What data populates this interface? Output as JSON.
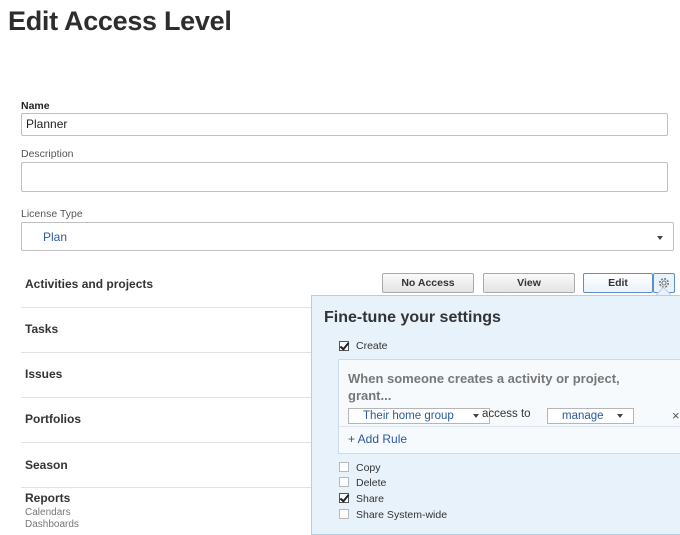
{
  "page": {
    "title": "Edit Access Level"
  },
  "form": {
    "name": {
      "label": "Name",
      "value": "Planner"
    },
    "description": {
      "label": "Description",
      "value": ""
    },
    "license_type": {
      "label": "License Type",
      "value": "Plan"
    }
  },
  "permissions": {
    "rows": [
      {
        "label": "Activities and projects"
      },
      {
        "label": "Tasks"
      },
      {
        "label": "Issues"
      },
      {
        "label": "Portfolios"
      },
      {
        "label": "Season"
      }
    ],
    "reports": {
      "label": "Reports",
      "sub_items": [
        "Calendars",
        "Dashboards"
      ]
    },
    "buttons": {
      "no_access": "No Access",
      "view": "View",
      "edit": "Edit"
    },
    "selected_level": "Edit"
  },
  "fine_tune": {
    "title": "Fine-tune your settings",
    "create": {
      "label": "Create",
      "checked": true
    },
    "rule": {
      "text": "When someone creates a activity or project, grant...",
      "who": "Their home group",
      "access_to_label": "access to",
      "level": "manage",
      "remove": "×",
      "add_rule": "+ Add Rule"
    },
    "options": [
      {
        "label": "Copy",
        "checked": false
      },
      {
        "label": "Delete",
        "checked": false
      },
      {
        "label": "Share",
        "checked": true
      },
      {
        "label": "Share System-wide",
        "checked": false
      }
    ]
  },
  "colors": {
    "link": "#2b5a9a",
    "popover_bg": "#e8f2fb",
    "active_border": "#5d8fc8"
  }
}
